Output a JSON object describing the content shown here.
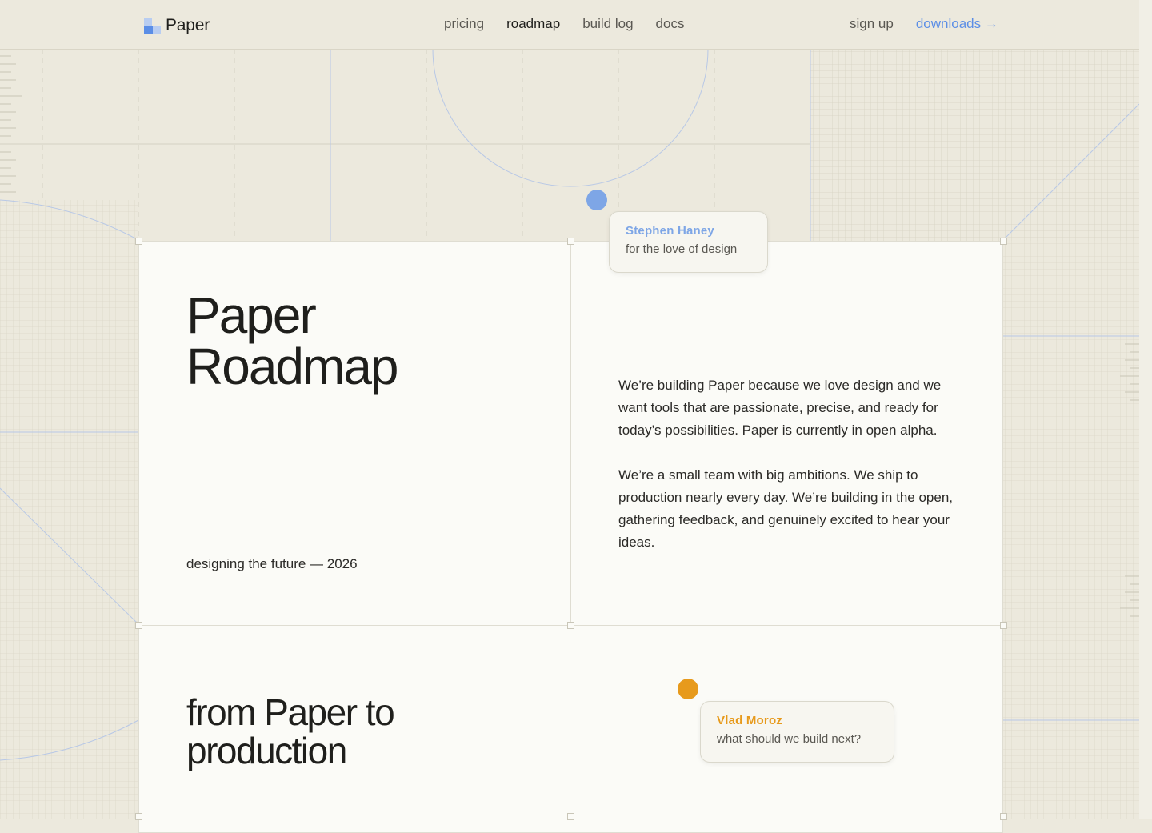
{
  "header": {
    "logo_text": "Paper",
    "nav": [
      {
        "label": "pricing",
        "active": false
      },
      {
        "label": "roadmap",
        "active": true
      },
      {
        "label": "build log",
        "active": false
      },
      {
        "label": "docs",
        "active": false
      }
    ],
    "signup_label": "sign up",
    "downloads_label": "downloads →"
  },
  "hero": {
    "title_line1": "Paper",
    "title_line2": "Roadmap",
    "tagline": "designing the future — 2026",
    "paragraph1": "We’re building Paper because we love design and we want tools that are passionate, precise, and ready for today’s possibilities. Paper is currently in open alpha.",
    "paragraph2": "We’re a small team with big ambitions. We ship to production nearly every day. We’re building in the open, gathering feedback, and genuinely excited to hear your ideas."
  },
  "section": {
    "title_line1": "from Paper to",
    "title_line2": "production"
  },
  "comments": [
    {
      "name": "Stephen Haney",
      "message": "for the love of design",
      "color": "#7ea6e6"
    },
    {
      "name": "Vlad Moroz",
      "message": "what should we build next?",
      "color": "#e79a1c"
    }
  ],
  "colors": {
    "background": "#ece9dd",
    "panel": "#fbfbf7",
    "accent_blue": "#5b8ee6",
    "accent_orange": "#e79a1c"
  }
}
